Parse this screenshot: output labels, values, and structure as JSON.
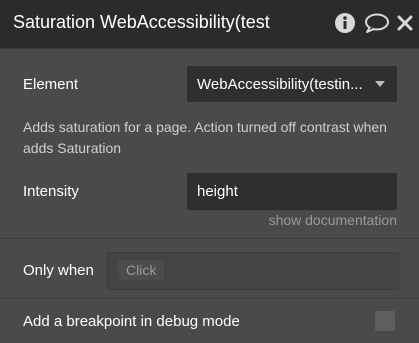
{
  "header": {
    "title": "Saturation WebAccessibility(test",
    "icons": [
      "info-icon",
      "comment-icon",
      "close-icon"
    ]
  },
  "element": {
    "label": "Element",
    "value": "WebAccessibility(testin..."
  },
  "description": "Adds saturation for a page. Action turned off contrast when adds Saturation",
  "intensity": {
    "label": "Intensity",
    "value": "height"
  },
  "show_documentation": "show documentation",
  "only_when": {
    "label": "Only when",
    "placeholder": "Click"
  },
  "breakpoint": {
    "label": "Add a breakpoint in debug mode",
    "checked": false
  },
  "colors": {
    "panel_bg": "#4a4a4a",
    "header_bg": "#2b2b2b",
    "field_bg": "#2f2f2f",
    "text": "#ffffff",
    "muted_text": "#9a9a9a"
  }
}
